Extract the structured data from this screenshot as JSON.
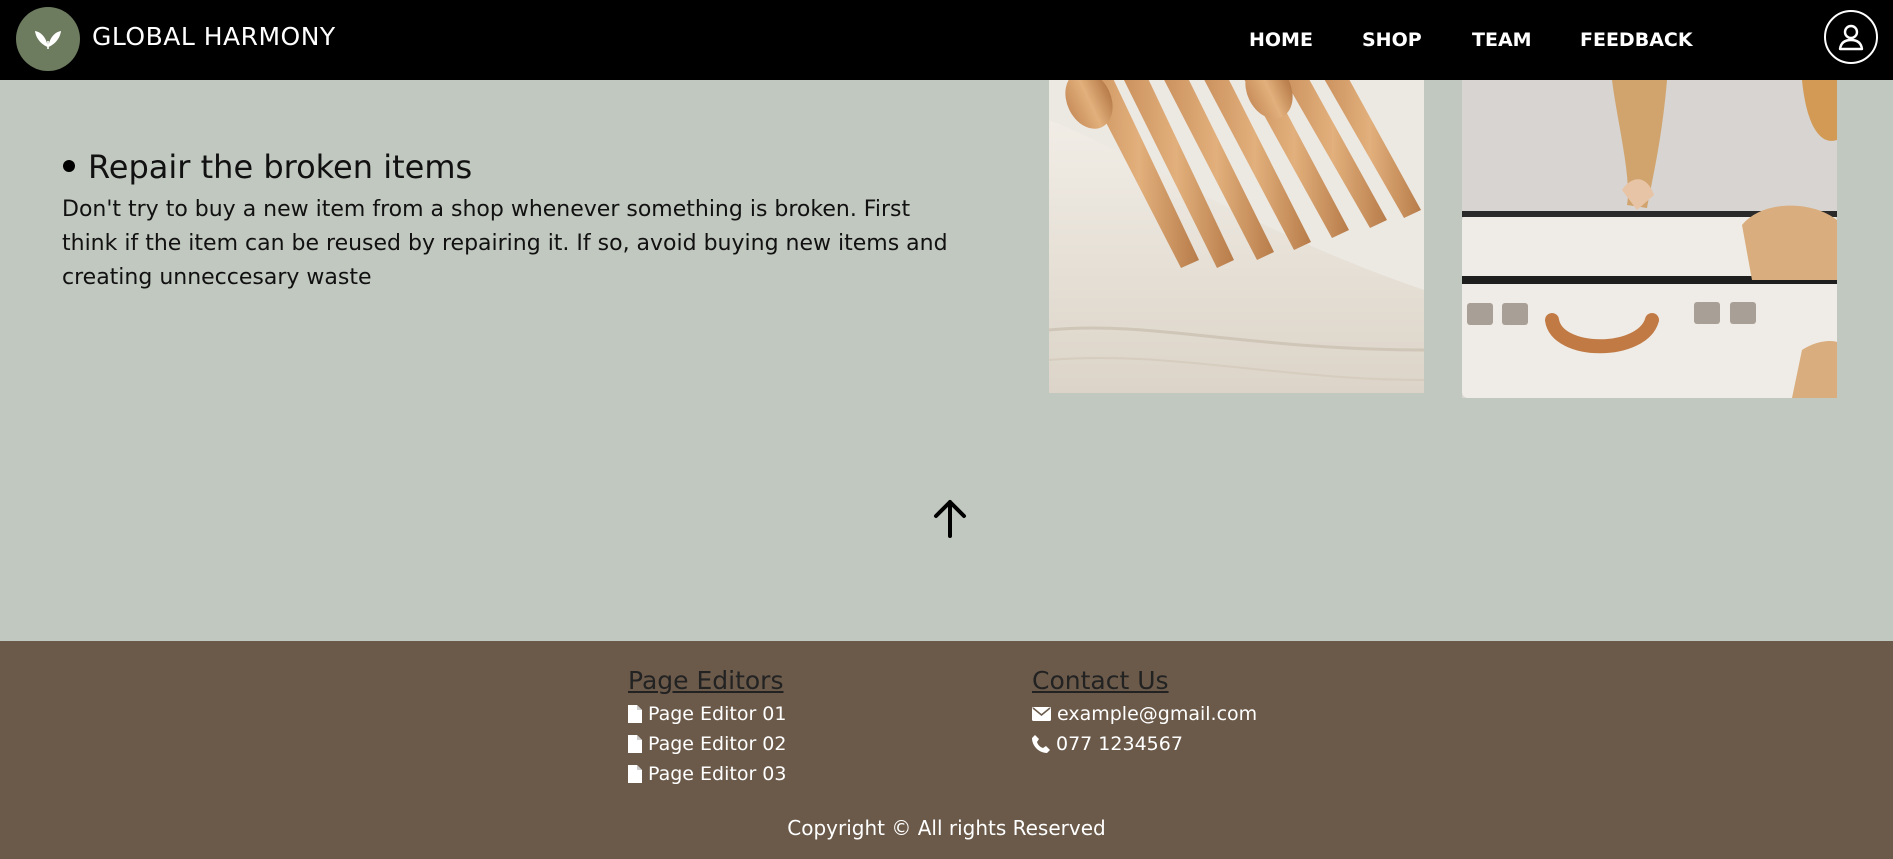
{
  "header": {
    "brand": "GLOBAL HARMONY",
    "logo_icon": "leaf-logo-icon",
    "nav": [
      {
        "label": "HOME"
      },
      {
        "label": "SHOP"
      },
      {
        "label": "TEAM"
      },
      {
        "label": "FEEDBACK"
      }
    ],
    "profile_icon": "user-icon"
  },
  "main": {
    "item_title": "Repair the broken items",
    "item_description": "Don't try to buy a new item from a shop whenever something is broken. First think if the item can be reused by repairing it. If so, avoid buying new items and creating unneccesary waste",
    "images": [
      {
        "subject": "wooden cutlery on cloth"
      },
      {
        "subject": "hands repairing white suitcase"
      }
    ],
    "back_to_top_icon": "arrow-up-icon"
  },
  "footer": {
    "editors_heading": "Page Editors",
    "editors": [
      {
        "label": "Page Editor 01",
        "icon": "file-icon"
      },
      {
        "label": "Page Editor 02",
        "icon": "file-icon"
      },
      {
        "label": "Page Editor 03",
        "icon": "file-icon"
      }
    ],
    "contact_heading": "Contact Us",
    "email": "example@gmail.com",
    "phone": "077 1234567",
    "copyright": "Copyright © All rights Reserved"
  },
  "colors": {
    "header_bg": "#000000",
    "page_bg": "#c1c8bf",
    "footer_bg": "#6b5a4a",
    "logo_bg": "#6d7b5f"
  }
}
